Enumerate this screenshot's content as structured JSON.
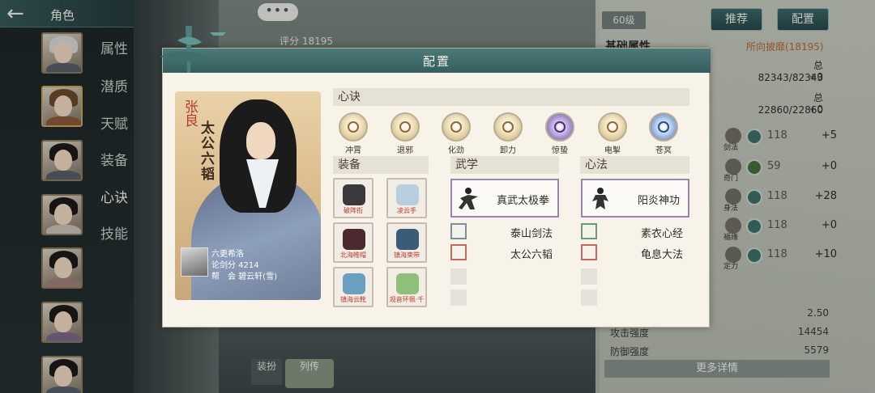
{
  "sidebar": {
    "title": "角色",
    "tabs": [
      "属性",
      "潜质",
      "天赋",
      "装备",
      "心诀",
      "技能"
    ]
  },
  "background": {
    "chat_bubble": "•••",
    "score": "评分 18195",
    "level": "60级",
    "buttons": {
      "recommend": "推荐",
      "config": "配置"
    },
    "basic_attr_title": "基础属性",
    "attr_source": "所向披靡(18195)",
    "right_values": [
      "总82343/82343",
      "+0",
      "总22860/22860",
      "+0"
    ],
    "stat_rows": [
      {
        "label": "剑法",
        "level": "118",
        "bonus": "+5"
      },
      {
        "label": "奇门",
        "level": "59",
        "bonus": "+0"
      },
      {
        "label": "身法",
        "level": "118",
        "bonus": "+28"
      },
      {
        "label": "福缘",
        "level": "118",
        "bonus": "+0"
      },
      {
        "label": "定力",
        "level": "118",
        "bonus": "+10"
      }
    ],
    "bottom_stats": [
      {
        "label": "",
        "value": "2.50"
      },
      {
        "label": "攻击强度",
        "value": "14454"
      },
      {
        "label": "防御强度",
        "value": "5579"
      }
    ],
    "more_details": "更多详情",
    "equip_btn": "装扮",
    "bio_btn": "列传"
  },
  "dialog": {
    "title": "配置",
    "character": {
      "name": "张良",
      "title": "太公六韬",
      "owner": {
        "name": "六更希洛",
        "score": "论剑分 4214",
        "guild": "帮　会 碧云轩(雪)"
      }
    },
    "xinjue": {
      "header": "心诀",
      "skills": [
        "冲霄",
        "退邪",
        "化劲",
        "卸力",
        "惊蛰",
        "电掣",
        "苍冥"
      ]
    },
    "equipment": {
      "header": "装备",
      "items": [
        "破阵衔",
        "凌云手",
        "北海帷帽",
        "镇海束带",
        "镇海云靴",
        "观音环佩·千"
      ]
    },
    "wuxue": {
      "header": "武学",
      "main": "真武太极拳",
      "subs": [
        "泰山剑法",
        "太公六韬"
      ]
    },
    "xinfa": {
      "header": "心法",
      "main": "阳炎神功",
      "subs": [
        "素衣心经",
        "龟息大法"
      ]
    }
  },
  "colors": {
    "teal_header": "#3f6b6b",
    "wuxue_border": "#9b83b3",
    "name_red": "#b33d2f",
    "source_orange": "#b46634"
  }
}
